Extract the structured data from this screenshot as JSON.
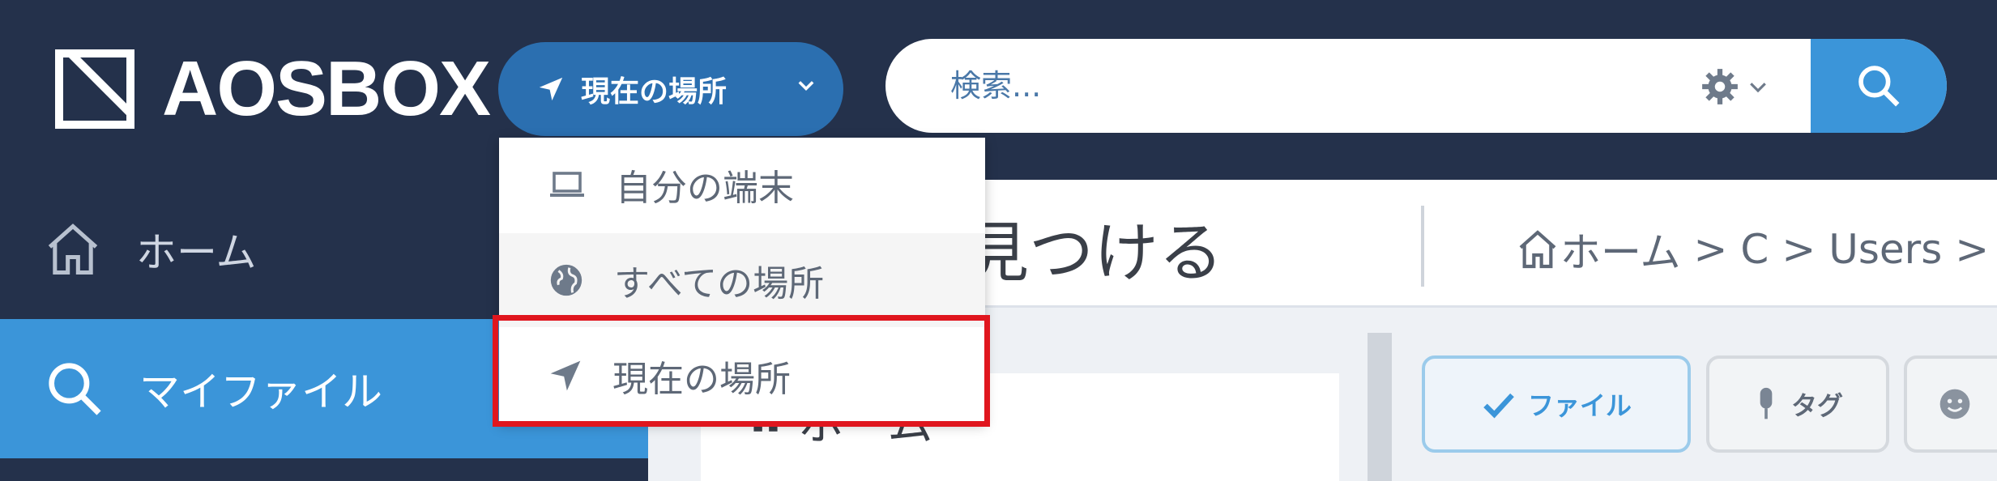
{
  "header": {
    "logo_text": "AOSBOX",
    "location_button_label": "現在の場所",
    "search": {
      "placeholder": "検索..."
    }
  },
  "location_menu": {
    "items": [
      {
        "label": "自分の端末",
        "icon": "laptop-icon"
      },
      {
        "label": "すべての場所",
        "icon": "globe-icon"
      },
      {
        "label": "現在の場所",
        "icon": "location-arrow-icon",
        "highlighted": true
      }
    ]
  },
  "sidebar": {
    "items": [
      {
        "label": "ホーム",
        "icon": "home-icon",
        "active": false
      },
      {
        "label": "マイファイル",
        "icon": "search-icon",
        "active": true
      }
    ]
  },
  "main": {
    "title_partial": "見つける",
    "breadcrumb": [
      "ホーム",
      "C",
      "Users"
    ],
    "breadcrumb_separator": ">",
    "tree_root_label": "ホーム",
    "filter_chips": [
      {
        "label": "ファイル",
        "selected": true
      },
      {
        "label": "タグ",
        "selected": false
      }
    ]
  },
  "colors": {
    "navbar_bg": "#24314b",
    "accent_blue": "#3b95d9",
    "location_button_bg": "#2b6fb0",
    "highlight_red": "#e0161e"
  }
}
